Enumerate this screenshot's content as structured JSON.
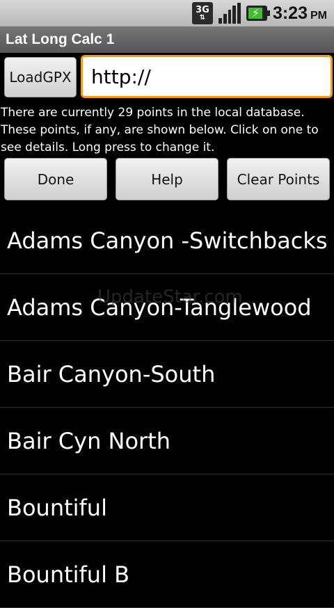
{
  "status_bar": {
    "network_type": "3G",
    "time": "3:23",
    "ampm": "PM",
    "icons": [
      "3g-data-icon",
      "signal-icon",
      "battery-charging-icon"
    ]
  },
  "app": {
    "title": "Lat Long Calc 1"
  },
  "toolbar": {
    "load_gpx_label": "LoadGPX",
    "url_value": "http://"
  },
  "info_text": "There are currently 29 points in the local database. These points, if any, are shown below.  Click on one to see details.  Long press to change it.",
  "buttons": {
    "done_label": "Done",
    "help_label": "Help",
    "clear_label": "Clear Points"
  },
  "points": [
    "Adams Canyon -Switchbacks",
    "Adams Canyon-Tanglewood",
    "Bair Canyon-South",
    "Bair Cyn North",
    "Bountiful",
    "Bountiful B"
  ],
  "watermark": "UpdateStar.com",
  "colors": {
    "focus_border": "#ff9a00",
    "background": "#000000"
  }
}
